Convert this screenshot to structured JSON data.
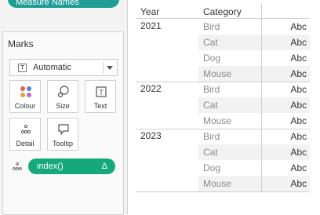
{
  "shelves": {
    "measure_names_pill": "Measure Names"
  },
  "marks": {
    "title": "Marks",
    "mark_type": "Automatic",
    "buttons": {
      "colour": "Colour",
      "size": "Size",
      "text": "Text",
      "detail": "Detail",
      "tooltip": "Tooltip"
    },
    "index_pill": {
      "label": "index()",
      "delta": "Δ"
    },
    "colors": {
      "measure_pill": "#1f9e96",
      "index_pill": "#15a87a"
    }
  },
  "table": {
    "headers": {
      "year": "Year",
      "category": "Category"
    },
    "groups": [
      {
        "year": "2021",
        "rows": [
          {
            "category": "Bird",
            "value": "Abc"
          },
          {
            "category": "Cat",
            "value": "Abc"
          },
          {
            "category": "Dog",
            "value": "Abc"
          },
          {
            "category": "Mouse",
            "value": "Abc"
          }
        ]
      },
      {
        "year": "2022",
        "rows": [
          {
            "category": "Bird",
            "value": "Abc"
          },
          {
            "category": "Cat",
            "value": "Abc"
          },
          {
            "category": "Mouse",
            "value": "Abc"
          }
        ]
      },
      {
        "year": "2023",
        "rows": [
          {
            "category": "Bird",
            "value": "Abc"
          },
          {
            "category": "Cat",
            "value": "Abc"
          },
          {
            "category": "Dog",
            "value": "Abc"
          },
          {
            "category": "Mouse",
            "value": "Abc"
          }
        ]
      }
    ]
  }
}
